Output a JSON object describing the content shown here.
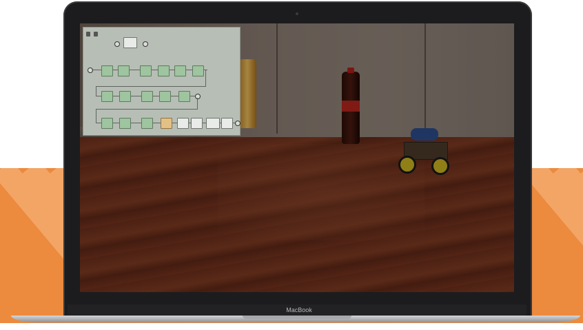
{
  "device": {
    "brand_label": "MacBook"
  },
  "scene": {
    "description_icons": [
      "laptop-icon",
      "robot-car-icon",
      "bottle-icon"
    ]
  },
  "colors": {
    "band_orange": "#ec8a3d",
    "band_stripe": "#f3a566",
    "node_green": "#9fc4a0",
    "node_orange": "#e3c184"
  }
}
